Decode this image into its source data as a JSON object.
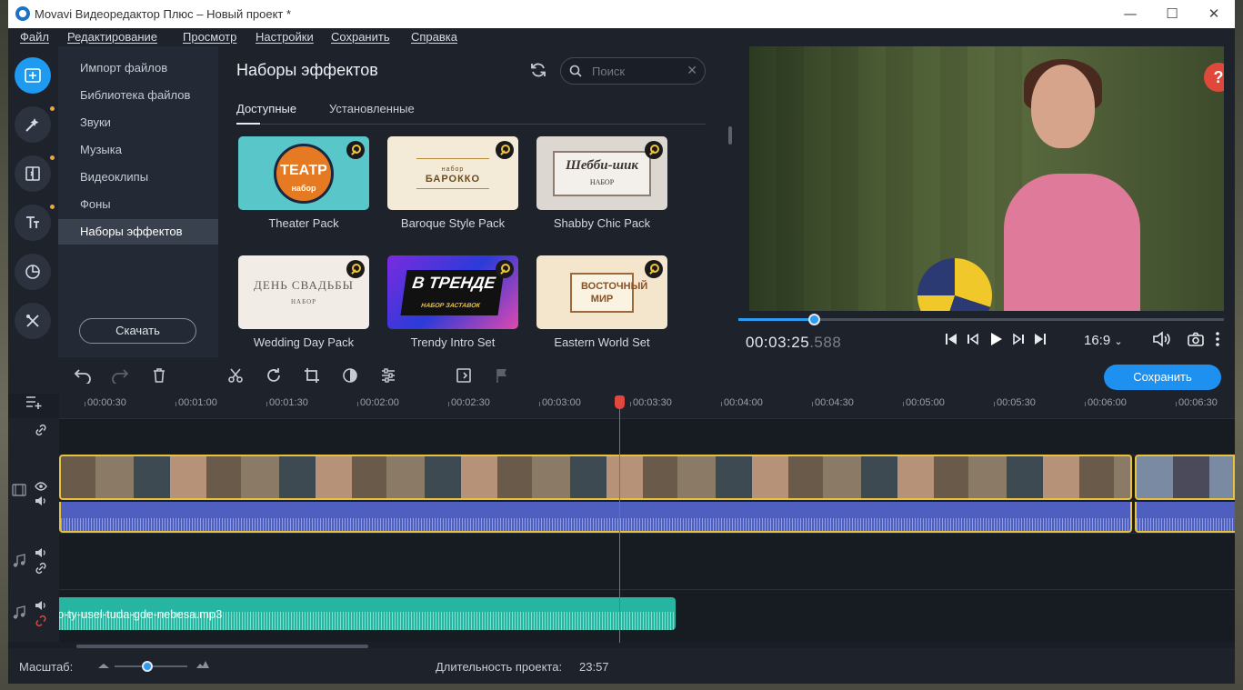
{
  "window": {
    "title": "Movavi Видеоредактор Плюс – Новый проект *"
  },
  "menu": [
    "Файл",
    "Редактирование",
    "Просмотр",
    "Настройки",
    "Сохранить",
    "Справка"
  ],
  "sidebar": {
    "categories": [
      "Импорт файлов",
      "Библиотека файлов",
      "Звуки",
      "Музыка",
      "Видеоклипы",
      "Фоны",
      "Наборы эффектов"
    ],
    "active": "Наборы эффектов",
    "download_label": "Скачать"
  },
  "panel": {
    "title": "Наборы эффектов",
    "search_placeholder": "Поиск",
    "tabs": [
      "Доступные",
      "Установленные"
    ],
    "active_tab": "Доступные",
    "cards": [
      {
        "label": "Theater Pack",
        "art": "ТЕАТР",
        "art_sub": "набор"
      },
      {
        "label": "Baroque Style Pack",
        "art": "БАРОККО",
        "art_sub": "набор"
      },
      {
        "label": "Shabby Chic Pack",
        "art": "Шебби-шик",
        "art_sub": "НАБОР"
      },
      {
        "label": "Wedding Day Pack",
        "art": "ДЕНЬ СВАДЬБЫ",
        "art_sub": "НАБОР"
      },
      {
        "label": "Trendy Intro Set",
        "art": "В ТРЕНДЕ",
        "art_sub": "НАБОР ЗАСТАВОК"
      },
      {
        "label": "Eastern World Set",
        "art": "ВОСТОЧНЫЙ МИР",
        "art_sub": ""
      }
    ]
  },
  "player": {
    "timecode_main": "00:03:25",
    "timecode_ms": ".588",
    "aspect": "16:9",
    "progress_fraction": 0.155,
    "help_glyph": "?"
  },
  "timeline": {
    "save_label": "Сохранить",
    "ruler_ticks": [
      "00:00:30",
      "00:01:00",
      "00:01:30",
      "00:02:00",
      "00:02:30",
      "00:03:00",
      "00:03:30",
      "00:04:00",
      "00:04:30",
      "00:05:00",
      "00:05:30",
      "00:06:00",
      "00:06:30"
    ],
    "music_clip_name": "o-ty-usel-tuda-gde-nebesa.mp3"
  },
  "status": {
    "zoom_label": "Масштаб:",
    "zoom_fraction": 0.45,
    "duration_label": "Длительность проекта:",
    "duration_value": "23:57"
  },
  "colors": {
    "accent": "#1e90f0",
    "clip_border": "#e8c23a",
    "audio_clip": "#4f5fbf",
    "music_clip": "#26b5a0",
    "playhead": "#e2473e"
  }
}
